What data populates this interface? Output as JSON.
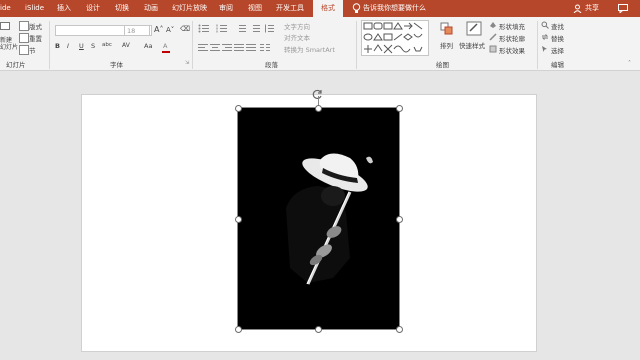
{
  "tabs": [
    "ide",
    "iSlide",
    "插入",
    "设计",
    "切换",
    "动画",
    "幻灯片放映",
    "审阅",
    "视图",
    "开发工具",
    "格式"
  ],
  "active_tab": "格式",
  "tell_me": "告诉我你想要做什么",
  "account": {
    "share": "共享"
  },
  "groups": {
    "slides": "幻灯片",
    "font": "字体",
    "paragraph": "段落",
    "drawing": "绘图",
    "editing": "编辑"
  },
  "slides_group": {
    "new_slide": "新建\n幻灯片",
    "layout": "版式",
    "reset": "重置",
    "section": "节"
  },
  "font_group": {
    "font_name": "",
    "font_size": "18",
    "bold": "B",
    "italic": "I",
    "underline": "U",
    "strike": "S",
    "shadow": "abc",
    "spacing": "AV",
    "case": "Aa",
    "color": "A"
  },
  "paragraph_group": {
    "text_direction": "文字方向",
    "align_text": "对齐文本",
    "convert_smartart": "转换为 SmartArt"
  },
  "drawing_group": {
    "arrange": "排列",
    "quick_styles": "快速样式",
    "shape_fill": "形状填充",
    "shape_outline": "形状轮廓",
    "shape_effects": "形状效果"
  },
  "editing_group": {
    "find": "查找",
    "replace": "替换",
    "select": "选择"
  },
  "colors": {
    "accent": "#b7472a",
    "ribbon_bg": "#f3f3f3",
    "canvas_bg": "#e6e6e6"
  }
}
